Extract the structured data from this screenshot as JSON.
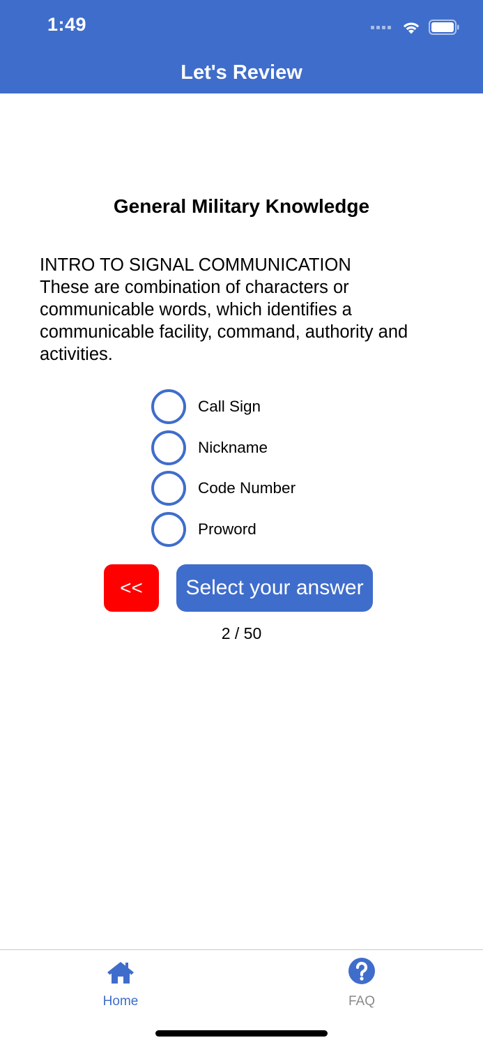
{
  "status_bar": {
    "time": "1:49"
  },
  "header": {
    "title": "Let's Review"
  },
  "quiz": {
    "category": "General Military Knowledge",
    "question_title": "INTRO TO SIGNAL COMMUNICATION",
    "question_text": "These are combination of characters or communicable words, which identifies a communicable facility, command, authority and activities.",
    "options": [
      {
        "label": "Call Sign"
      },
      {
        "label": "Nickname"
      },
      {
        "label": "Code Number"
      },
      {
        "label": "Proword"
      }
    ],
    "back_label": "<<",
    "answer_label": "Select your answer",
    "progress": "2 / 50"
  },
  "tabs": [
    {
      "label": "Home",
      "icon": "home-icon"
    },
    {
      "label": "FAQ",
      "icon": "question-circle-icon"
    }
  ],
  "colors": {
    "accent": "#3f6dcb",
    "back_button": "#fe0000",
    "tab_inactive": "#8a8a8a"
  }
}
